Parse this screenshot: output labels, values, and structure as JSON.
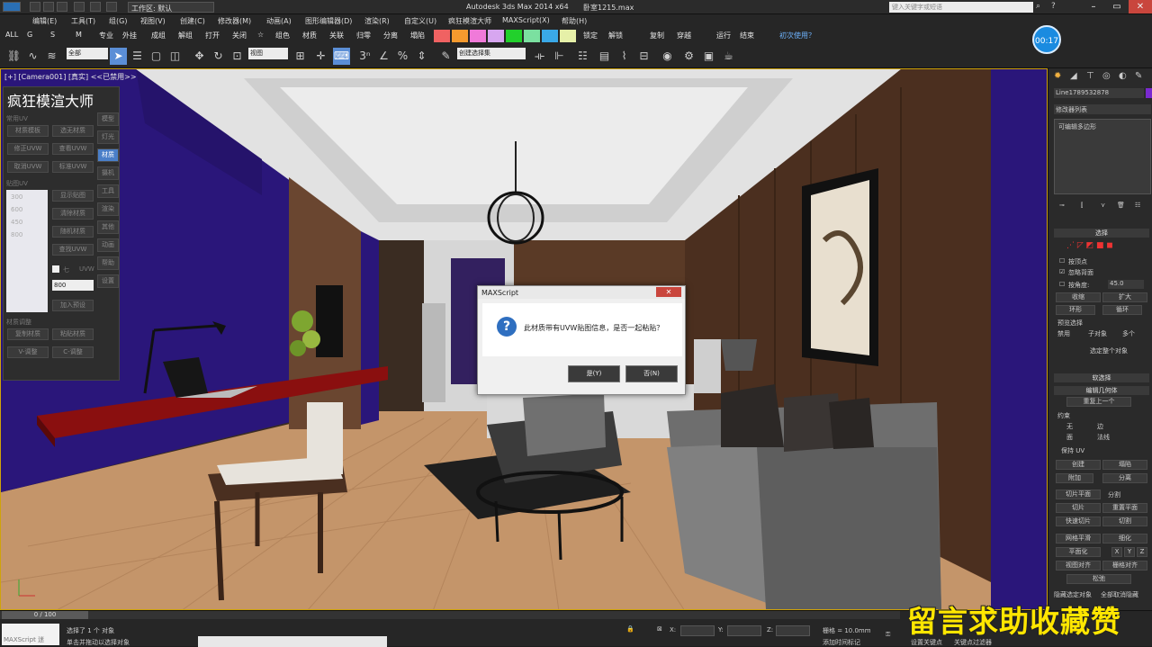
{
  "titlebar": {
    "workspace": "工作区: 默认",
    "app_title": "Autodesk 3ds Max  2014 x64",
    "file_name": "卧室1215.max",
    "search_placeholder": "键入关键字或短语"
  },
  "menu": [
    "编辑(E)",
    "工具(T)",
    "组(G)",
    "视图(V)",
    "创建(C)",
    "修改器(M)",
    "动画(A)",
    "图形编辑器(D)",
    "渲染(R)",
    "自定义(U)",
    "疯狂模渲大师",
    "MAXScript(X)",
    "帮助(H)"
  ],
  "toolbar_row2": {
    "left_tabs": [
      "ALL",
      "G",
      "S",
      "M"
    ],
    "commands_a": [
      "专业",
      "外挂",
      "成组",
      "解组",
      "打开",
      "关闭",
      "☆",
      "组色",
      "材质",
      "关联"
    ],
    "commands_b": [
      "归零",
      "分离",
      "塌陷"
    ],
    "commands_c": [
      "锁定",
      "解锁",
      "复制",
      "穿越",
      "运行",
      "结束",
      "初次使用？"
    ],
    "swatch_colors": [
      "#f06262",
      "#f59a2e",
      "#f07ad9",
      "#d7a6f0",
      "#22d02c",
      "#7be0a0",
      "#3aa9e8",
      "#e6f0a8"
    ]
  },
  "toolbar_row3": {
    "selection_filter": "全部",
    "ref_coord": "视图",
    "named_selection": "创建选择集"
  },
  "timer": "00:17",
  "viewport": {
    "label": "[+] [Camera001] [真实]  <<已禁用>>"
  },
  "plugin": {
    "title": "疯狂模渲大师",
    "section_uv": "常用UV",
    "uv_buttons": [
      "材质模板",
      "选无材质",
      "修正UVW",
      "查看UVW",
      "取消UVW",
      "标准UVW"
    ],
    "section_tex": "贴图UV",
    "sizes": [
      "300",
      "600",
      "450",
      "800"
    ],
    "tex_buttons": [
      "显示贴图",
      "清除材质",
      "随机材质",
      "查找UVW"
    ],
    "checkbox_labels": [
      "七",
      "UVW"
    ],
    "size_value": "800",
    "add_button": "加入预设",
    "section_other": "材质调整",
    "bottom_buttons": [
      "复制材质",
      "粘贴材质",
      "V-调整",
      "C-调整"
    ],
    "side_tabs": [
      "模型",
      "灯光",
      "材质",
      "摄机",
      "工具",
      "渲染",
      "其他",
      "动画",
      "帮助",
      "设置"
    ]
  },
  "dialog": {
    "title": "MAXScript",
    "close": "✕",
    "message": "此材质带有UVW贴图信息，是否一起粘贴？",
    "yes": "是(Y)",
    "no": "否(N)"
  },
  "right_panel": {
    "object_name": "Line1789532878",
    "modifier_list": "修改器列表",
    "stack_item": "可编辑多边形",
    "sel_header": "选择",
    "by_vertex": "按顶点",
    "ignore_back": "忽略背面",
    "by_angle": "按角度:",
    "angle_value": "45.0",
    "shrink": "收缩",
    "grow": "扩大",
    "ring": "环形",
    "loop": "循环",
    "preview_sel": "预览选择",
    "preview_opts": [
      "禁用",
      "子对象",
      "多个"
    ],
    "select_all": "选定整个对象",
    "soft_sel": "软选择",
    "edit_geo": "编辑几何体",
    "repeat_last": "重复上一个",
    "constraints": "约束",
    "constraint_opts": [
      "无",
      "边",
      "面",
      "法线"
    ],
    "preserve_uv": "保持 UV",
    "create": "创建",
    "collapse": "塌陷",
    "attach": "附加",
    "detach": "分离",
    "slice_plane": "切片平面",
    "split": "分割",
    "slice": "切片",
    "reset_plane": "重置平面",
    "quickslice": "快速切片",
    "cut": "切割",
    "meshsmooth": "网格平滑",
    "tessellate": "细化",
    "make_planar": "平面化",
    "xyz": [
      "X",
      "Y",
      "Z"
    ],
    "view_align": "视图对齐",
    "grid_align": "栅格对齐",
    "relax": "松弛",
    "hide_sel": "隐藏选定对象",
    "unhide_all": "全部取消隐藏"
  },
  "bottom": {
    "frame": "0 / 100",
    "maxscript": "MAXScript 迷",
    "status": "选择了 1 个 对象",
    "prompt": "单击并拖动以选择对象",
    "x_label": "X:",
    "y_label": "Y:",
    "z_label": "Z:",
    "grid": "栅格 = 10.0mm",
    "add_time_tag": "添加时间标记",
    "auto_key": "设置关键点",
    "key_filter": "关键点过滤器"
  },
  "promo": "留言求助收藏赞"
}
